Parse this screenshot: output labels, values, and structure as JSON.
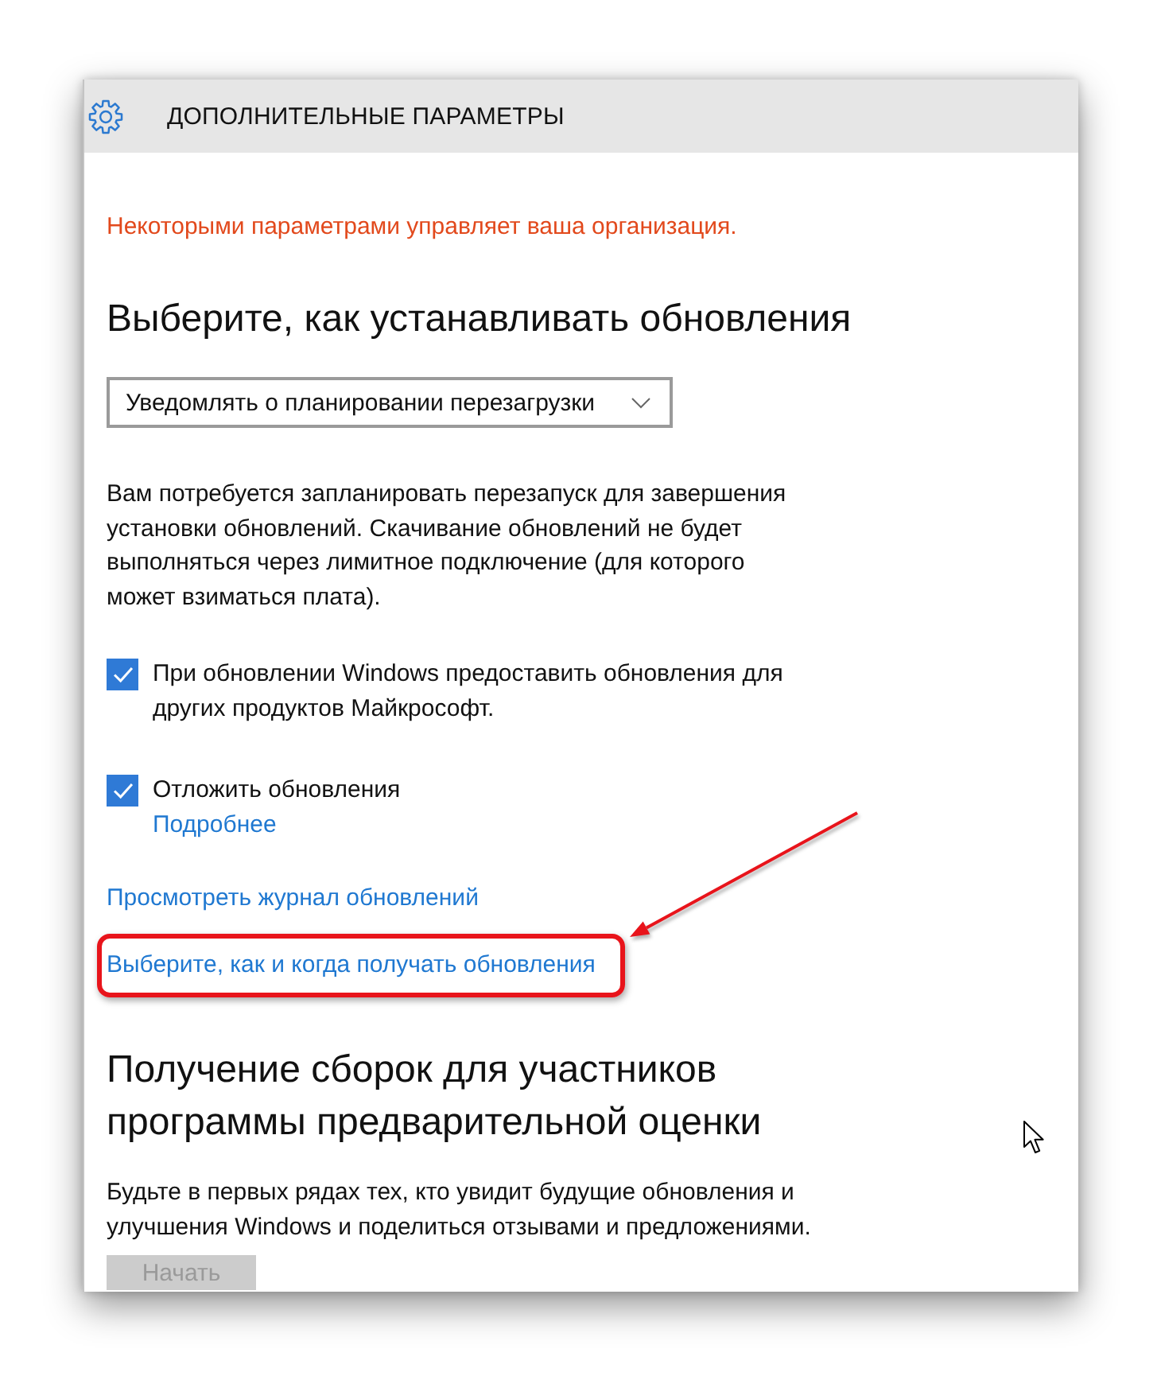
{
  "window": {
    "title": "ДОПОЛНИТЕЛЬНЫЕ ПАРАМЕТРЫ"
  },
  "notice": "Некоторыми параметрами управляет ваша организация.",
  "install_section": {
    "heading": "Выберите, как устанавливать обновления",
    "dropdown": {
      "value": "Уведомлять о планировании перезагрузки"
    },
    "description": "Вам потребуется запланировать перезапуск для завершения установки обновлений. Скачивание обновлений не будет выполняться через лимитное подключение (для которого может взиматься плата)."
  },
  "options": [
    {
      "label": "При обновлении Windows предоставить обновления для других продуктов Майкрософт.",
      "checked": true
    },
    {
      "label": "Отложить обновления",
      "checked": true,
      "link": "Подробнее"
    }
  ],
  "links": [
    {
      "text": "Просмотреть журнал обновлений",
      "highlighted": false
    },
    {
      "text": "Выберите, как и когда получать обновления",
      "highlighted": true
    }
  ],
  "insider": {
    "heading": "Получение сборок для участников программы предварительной оценки",
    "description": "Будьте в первых рядах тех, кто увидит будущие обновления и улучшения Windows и поделиться отзывами и предложениями.",
    "button": {
      "label": "Начать",
      "disabled": true
    }
  }
}
